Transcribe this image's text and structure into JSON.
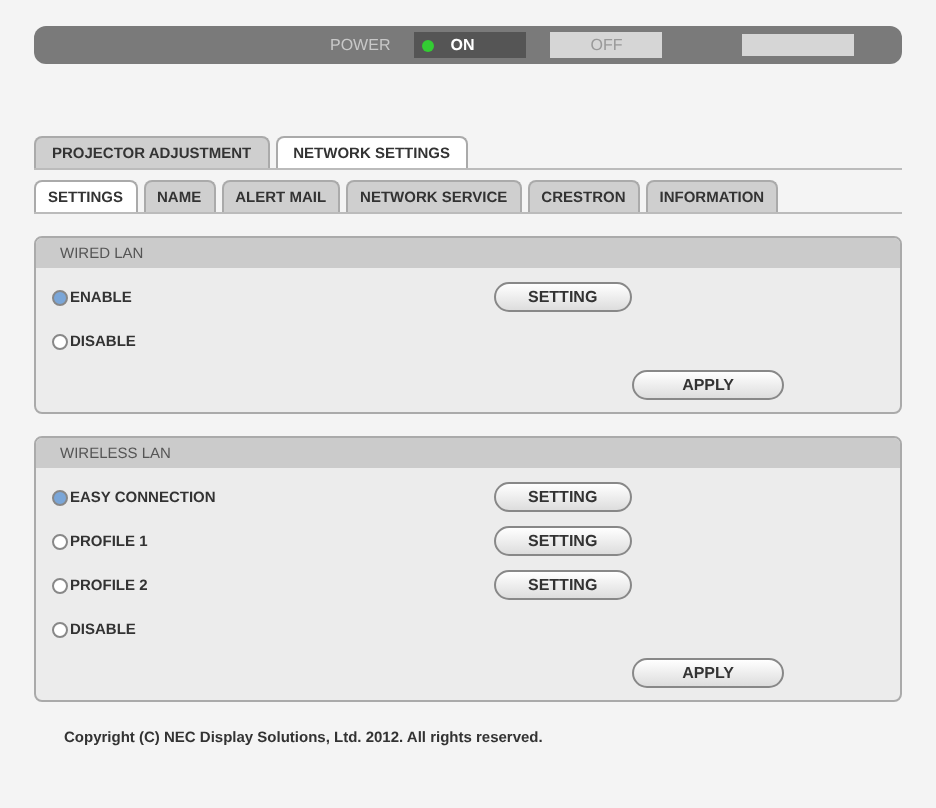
{
  "power_bar": {
    "label": "POWER",
    "buttons": [
      {
        "label": "ON",
        "selected": true
      },
      {
        "label": "OFF",
        "selected": false
      }
    ]
  },
  "main_tabs": [
    {
      "label": "PROJECTOR ADJUSTMENT",
      "selected": false
    },
    {
      "label": "NETWORK SETTINGS",
      "selected": true
    }
  ],
  "sub_tabs": [
    {
      "label": "SETTINGS",
      "selected": true
    },
    {
      "label": "NAME",
      "selected": false
    },
    {
      "label": "ALERT MAIL",
      "selected": false
    },
    {
      "label": "NETWORK SERVICE",
      "selected": false
    },
    {
      "label": "CRESTRON",
      "selected": false
    },
    {
      "label": "INFORMATION",
      "selected": false
    }
  ],
  "panels": [
    {
      "title": "WIRED LAN",
      "options": [
        {
          "label": "ENABLE",
          "selected": true,
          "button": "SETTING"
        },
        {
          "label": "DISABLE",
          "selected": false
        }
      ],
      "apply": "APPLY"
    },
    {
      "title": "WIRELESS LAN",
      "options": [
        {
          "label": "EASY CONNECTION",
          "selected": true,
          "button": "SETTING"
        },
        {
          "label": "PROFILE 1",
          "selected": false,
          "button": "SETTING"
        },
        {
          "label": "PROFILE 2",
          "selected": false,
          "button": "SETTING"
        },
        {
          "label": "DISABLE",
          "selected": false
        }
      ],
      "apply": "APPLY"
    }
  ],
  "footer": "Copyright (C) NEC Display Solutions, Ltd. 2012. All rights reserved."
}
